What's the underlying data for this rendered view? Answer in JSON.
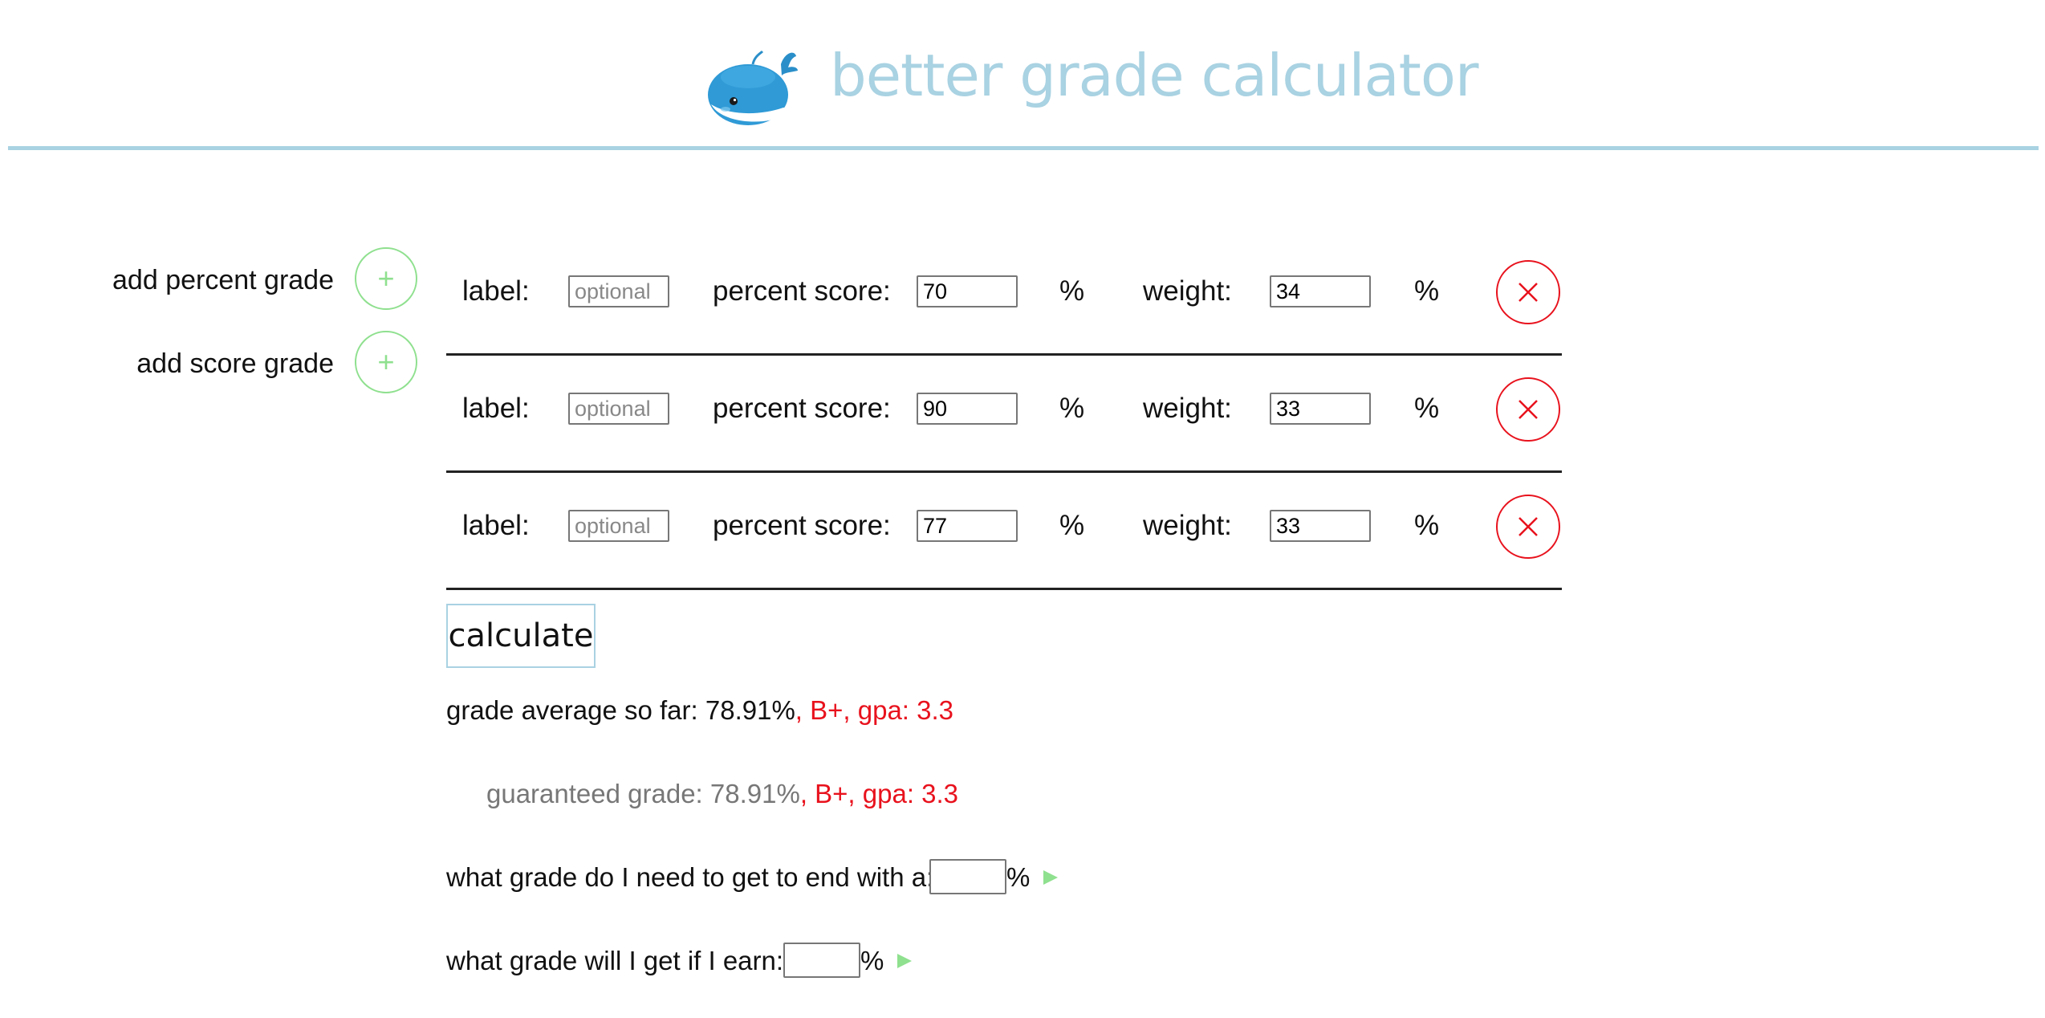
{
  "header": {
    "title": "better grade calculator",
    "logo_icon": "whale-icon"
  },
  "sidebar": {
    "add_percent_label": "add percent grade",
    "add_score_label": "add score grade",
    "add_icon": "+",
    "accent_color": "#8fe08f"
  },
  "grades": [
    {
      "label_text": "label:",
      "label_placeholder": "optional",
      "score_text": "percent score:",
      "score": "70",
      "pct1": "%",
      "weight_text": "weight:",
      "weight": "34",
      "pct2": "%"
    },
    {
      "label_text": "label:",
      "label_placeholder": "optional",
      "score_text": "percent score:",
      "score": "90",
      "pct1": "%",
      "weight_text": "weight:",
      "weight": "33",
      "pct2": "%"
    },
    {
      "label_text": "label:",
      "label_placeholder": "optional",
      "score_text": "percent score:",
      "score": "77",
      "pct1": "%",
      "weight_text": "weight:",
      "weight": "33",
      "pct2": "%"
    }
  ],
  "calculate_label": "calculate",
  "average": {
    "prefix": "grade average so far: 78.91%",
    "suffix": ", B+, gpa: 3.3"
  },
  "guaranteed": {
    "prefix": "guaranteed grade: 78.91%",
    "suffix": ", B+, gpa: 3.3"
  },
  "need_question": {
    "text": "what grade do I need to get to end with a:",
    "unit": "%"
  },
  "earn_question": {
    "text": "what grade will I get if I earn:",
    "unit": "%"
  },
  "colors": {
    "brand": "#a9d2e2",
    "remove": "#e8121d",
    "go": "#8fe08f",
    "letter_grade": "#e8121d"
  }
}
